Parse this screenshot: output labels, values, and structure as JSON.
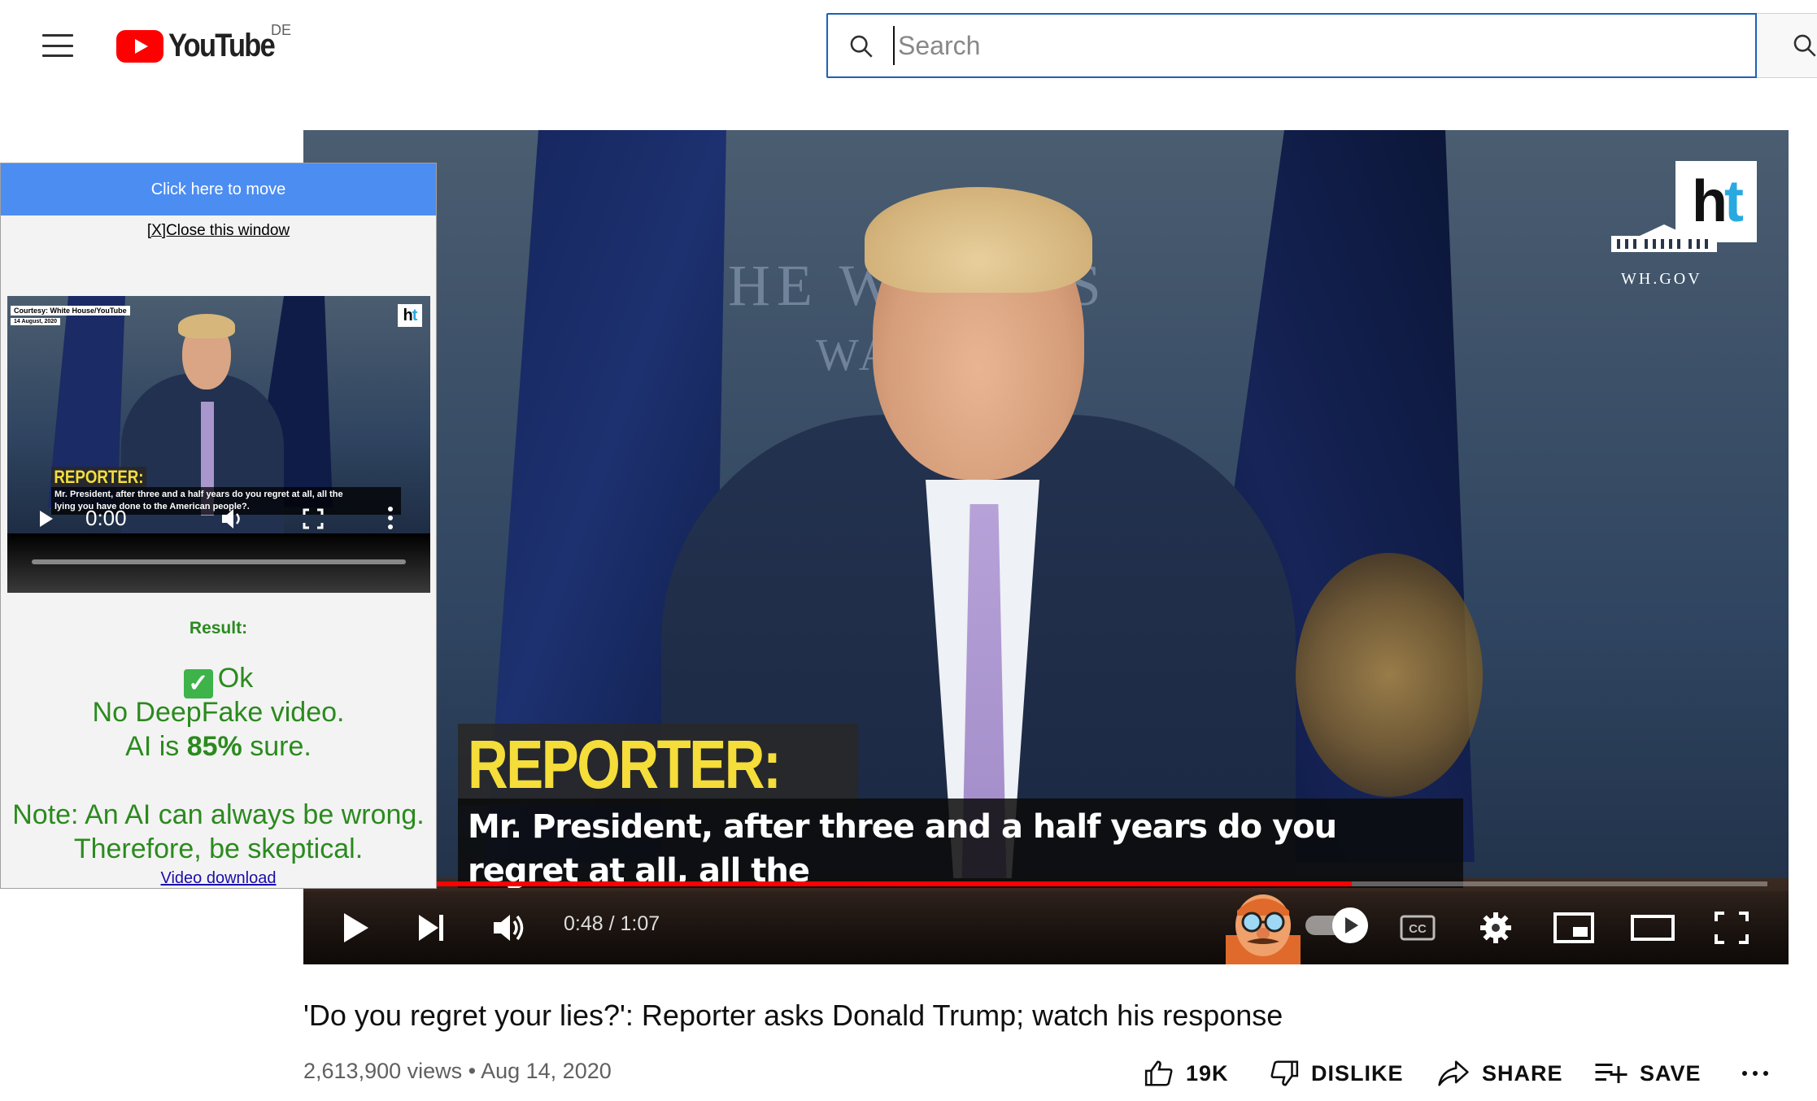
{
  "header": {
    "logo_text": "YouTube",
    "region": "DE",
    "search_placeholder": "Search"
  },
  "player": {
    "channel_logo": "ht",
    "wh_label": "WH.GOV",
    "sign_line1": "THE WH   OUS",
    "sign_line2": "WAS",
    "reporter_label": "REPORTER:",
    "caption": "Mr. President, after three and a half years do you regret at all, all the\nlying you have done to the American people?.",
    "time": "0:48 / 1:07",
    "progress": 0.716,
    "cc_label": "CC"
  },
  "overlay": {
    "move_label": "Click here to move",
    "close_label": "[X]Close this window",
    "mini": {
      "courtesy": "Courtesy: White House/YouTube",
      "date": "14 August, 2020",
      "logo": "ht",
      "reporter_label": "REPORTER:",
      "caption": "Mr. President, after three and a half years do you regret at all, all the\nlying you have done to the American people?.",
      "time": "0:00"
    },
    "result_label": "Result:",
    "ok_label": "Ok",
    "verdict": "No DeepFake video.",
    "confidence_prefix": "AI is ",
    "confidence_value": "85%",
    "confidence_suffix": " sure.",
    "note_line1": "Note: An AI can always be wrong.",
    "note_line2": "Therefore, be skeptical.",
    "download_label": "Video download",
    "accent_color": "#2b8a1e",
    "header_color": "#4c8df2"
  },
  "video": {
    "title": "'Do you regret your lies?': Reporter asks Donald Trump; watch his response",
    "views": "2,613,900 views",
    "date": "Aug 14, 2020",
    "meta_sep": " • ",
    "likes": "19K",
    "dislike_label": "DISLIKE",
    "share_label": "SHARE",
    "save_label": "SAVE"
  },
  "icons": [
    "menu-icon",
    "youtube-logo-icon",
    "search-icon",
    "play-icon",
    "next-icon",
    "volume-icon",
    "cc-icon",
    "settings-icon",
    "miniplayer-icon",
    "theater-icon",
    "fullscreen-icon",
    "like-icon",
    "dislike-icon",
    "share-icon",
    "save-icon",
    "more-icon",
    "checkmark-icon"
  ]
}
